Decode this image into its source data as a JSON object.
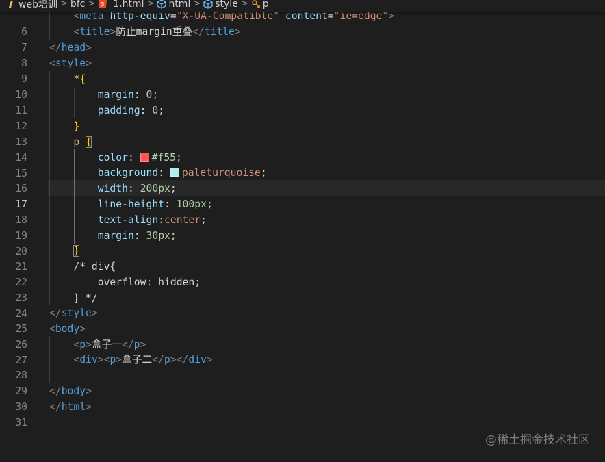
{
  "breadcrumb": {
    "items": [
      {
        "label": "web培训",
        "icon": "folder-icon"
      },
      {
        "label": "bfc",
        "icon": ""
      },
      {
        "label": "1.html",
        "icon": "html5-icon"
      },
      {
        "label": "html",
        "icon": "cube-icon"
      },
      {
        "label": "style",
        "icon": "cube-icon"
      },
      {
        "label": "p",
        "icon": "selector-icon"
      }
    ],
    "separator": ">"
  },
  "editor": {
    "active_line": 17,
    "lines": [
      {
        "num": "6",
        "text": "    <meta http-equiv=\"X-UA-Compatible\" content=\"ie=edge\">"
      },
      {
        "num": "7",
        "text": "    <title>防止margin重叠</title>"
      },
      {
        "num": "8",
        "text": "</head>"
      },
      {
        "num": "9",
        "text": "<style>"
      },
      {
        "num": "10",
        "text": "    *{"
      },
      {
        "num": "11",
        "text": "        margin: 0;"
      },
      {
        "num": "12",
        "text": "        padding: 0;"
      },
      {
        "num": "13",
        "text": "    }"
      },
      {
        "num": "14",
        "text": "    p {"
      },
      {
        "num": "15",
        "text": "        color: #f55;"
      },
      {
        "num": "16",
        "text": "        background: paleturquoise;"
      },
      {
        "num": "17",
        "text": "        width: 200px;"
      },
      {
        "num": "18",
        "text": "        line-height: 100px;"
      },
      {
        "num": "19",
        "text": "        text-align:center;"
      },
      {
        "num": "20",
        "text": "        margin: 30px;"
      },
      {
        "num": "21",
        "text": "    }"
      },
      {
        "num": "22",
        "text": "    /* div{"
      },
      {
        "num": "23",
        "text": "        overflow: hidden;"
      },
      {
        "num": "24",
        "text": "    } */"
      },
      {
        "num": "25",
        "text": "</style>"
      },
      {
        "num": "26",
        "text": "<body>"
      },
      {
        "num": "27",
        "text": "    <p>盒子一</p>"
      },
      {
        "num": "28",
        "text": "    <div><p>盒子二</p></div>"
      },
      {
        "num": "29",
        "text": ""
      },
      {
        "num": "30",
        "text": "</body>"
      },
      {
        "num": "31",
        "text": "</html>"
      }
    ]
  },
  "tokens": {
    "l6": {
      "tag_meta": "meta",
      "attr1": "http-equiv",
      "val1": "\"X-UA-Compatible\"",
      "attr2": "content",
      "val2": "\"ie=edge\""
    },
    "l7": {
      "tag": "title",
      "text": "防止margin重叠"
    },
    "l8": {
      "tag": "head"
    },
    "l9": {
      "tag": "style"
    },
    "l10": {
      "sel": "*"
    },
    "l11": {
      "prop": "margin",
      "num": "0"
    },
    "l12": {
      "prop": "padding",
      "num": "0"
    },
    "l14": {
      "sel": "p"
    },
    "l15": {
      "prop": "color",
      "value": "#f55"
    },
    "l16": {
      "prop": "background",
      "value": "paleturquoise"
    },
    "l17": {
      "prop": "width",
      "num": "200",
      "unit": "px"
    },
    "l18": {
      "prop": "line-height",
      "num": "100",
      "unit": "px"
    },
    "l19": {
      "prop": "text-align",
      "value": "center"
    },
    "l20": {
      "prop": "margin",
      "num": "30",
      "unit": "px"
    },
    "l22": {
      "comment": "/* div{"
    },
    "l23": {
      "comment": "overflow: hidden;"
    },
    "l24": {
      "comment": "} */"
    },
    "l25": {
      "tag": "style"
    },
    "l26": {
      "tag": "body"
    },
    "l27": {
      "tag": "p",
      "text": "盒子一"
    },
    "l28": {
      "tag_outer": "div",
      "tag_inner": "p",
      "text": "盒子二"
    },
    "l30": {
      "tag": "body"
    },
    "l31": {
      "tag": "html"
    }
  },
  "swatches": {
    "color": "#ff5555",
    "background": "#afeeee"
  },
  "watermark": "@稀土掘金技术社区"
}
